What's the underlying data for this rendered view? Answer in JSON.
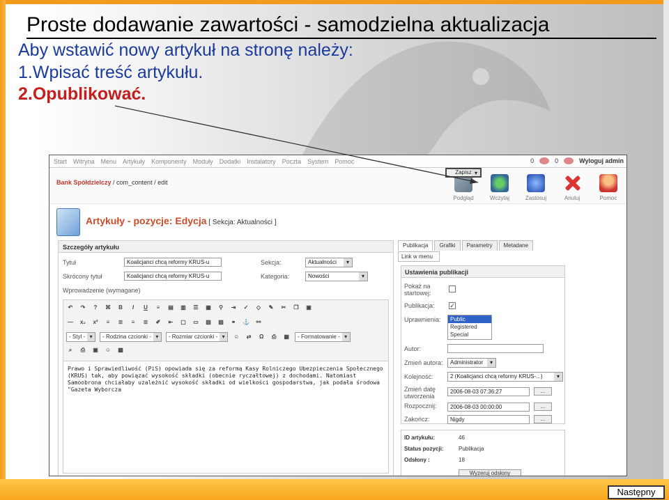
{
  "slide": {
    "title": "Proste dodawanie zawartości - samodzielna aktualizacja",
    "line1": "Aby wstawić nowy artykuł na stronę należy:",
    "line2": "1.Wpisać treść artykułu.",
    "line3": "2.Opublikować.",
    "next_label": "Następny"
  },
  "cms": {
    "menu": [
      "Start",
      "Witryna",
      "Menu",
      "Artykuły",
      "Komponenty",
      "Moduły",
      "Dodatki",
      "Instalatory",
      "Poczta",
      "System",
      "Pomoc"
    ],
    "online_count": "0",
    "admin_count": "0",
    "logout": "Wyloguj admin",
    "breadcrumb_site": "Bank Spółdzielczy",
    "breadcrumb_path": " / com_content / edit",
    "toolbar": [
      {
        "label": "Podgląd",
        "icon": "preview-icon"
      },
      {
        "label": "Wczytaj",
        "icon": "load-icon"
      },
      {
        "label": "Zapisz",
        "icon": "save-icon"
      },
      {
        "label": "Zastosuj",
        "icon": "apply-icon"
      },
      {
        "label": "Anuluj",
        "icon": "cancel-icon"
      },
      {
        "label": "Pomoc",
        "icon": "help-icon"
      }
    ],
    "page_title": "Artykuły - pozycje: ",
    "page_title_mode": "Edycja",
    "page_title_section": " [ Sekcja: Aktualności ]",
    "details": {
      "header": "Szczegóły artykułu",
      "title_label": "Tytuł",
      "title_value": "Koalicjanci chcą reformy KRUS-u",
      "alias_label": "Skrócony tytuł",
      "alias_value": "Koalicjanci chcą reformy KRUS-u",
      "section_label": "Sekcja:",
      "section_value": "Aktualności",
      "category_label": "Kategoria:",
      "category_value": "Nowości",
      "intro_label": "Wprowadzenie (wymagane)"
    },
    "editor": {
      "style_select": "- Styl -",
      "font_select": "- Rodzina czcionki -",
      "size_select": "- Rozmiar czcionki -",
      "format_select": "- Formatowanie -",
      "b": "B",
      "i": "I",
      "u": "U",
      "text": "Prawo i Sprawiedliwość (PiS) opowiada się za reformą Kasy Rolniczego Ubezpieczenia Społecznego (KRUS) tak, aby powiązać wysokość składki (obecnie ryczałtowej) z dochodami. Natomiast Samoobrona chciałaby uzależnić wysokość składki od wielkości gospodarstwa, jak podała środowa \"Gazeta Wyborcza"
    },
    "tabs": [
      "Publikacja",
      "Grafiki",
      "Parametry",
      "Metadane"
    ],
    "subtab": "Link w menu",
    "publish": {
      "header": "Ustawienia publikacji",
      "frontpage_label": "Pokaż na startowej:",
      "published_label": "Publikacja:",
      "access_label": "Uprawnienia:",
      "access_options": [
        "Public",
        "Registered",
        "Special"
      ],
      "author_label": "Autor:",
      "created_by_label": "Zmień autora:",
      "created_by_value": "Administrator",
      "ordering_label": "Kolejność:",
      "ordering_value": "2 (Koalicjanci chcą reformy KRUS-...)",
      "created_label": "Zmień datę utworzenia",
      "created_value": "2006-08-03 07:36:27",
      "start_label": "Rozpocznij:",
      "start_value": "2006-08-03 00:00:00",
      "end_label": "Zakończ:",
      "end_value": "Nigdy",
      "dots": "..."
    },
    "info": {
      "id_label": "ID artykułu:",
      "id_value": "46",
      "status_label": "Status pozycji:",
      "status_value": "Publikacja",
      "hits_label": "Odsłony :",
      "hits_value": "18",
      "reset_button": "Wyzeruj odsłony"
    }
  },
  "colors": {
    "frame": "#f39a1a",
    "title_blue": "#1a3a9c",
    "highlight_red": "#c41e1e"
  }
}
